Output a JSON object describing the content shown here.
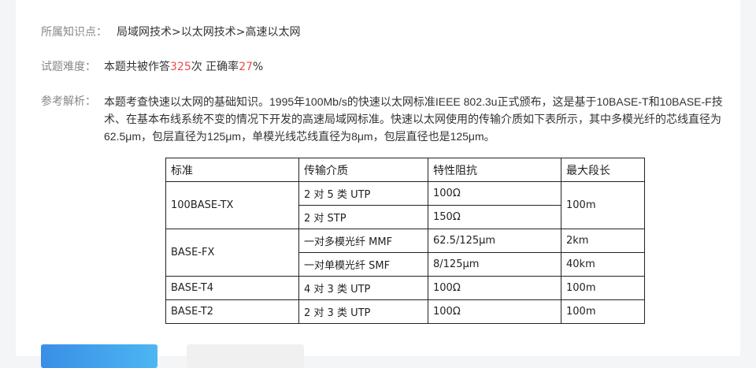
{
  "knowledge": {
    "label": "所属知识点：",
    "value": "局域网技术>以太网技术>高速以太网"
  },
  "difficulty": {
    "label": "试题难度：",
    "prefix": "本题共被作答",
    "count": "325",
    "mid": "次 正确率",
    "rate": "27",
    "suffix": "%"
  },
  "analysis": {
    "label": "参考解析：",
    "text": "本题考查快速以太网的基础知识。1995年100Mb/s的快速以太网标准IEEE 802.3u正式颁布，这是基于10BASE-T和10BASE-F技术、在基本布线系统不变的情况下开发的高速局域网标准。快速以太网使用的传输介质如下表所示，其中多模光纤的芯线直径为62.5μm，包层直径为125μm，单模光线芯线直径为8μm，包层直径也是125μm。"
  },
  "table": {
    "headers": [
      "标准",
      "传输介质",
      "特性阻抗",
      "最大段长"
    ],
    "rows": [
      {
        "standard": "100BASE-TX",
        "media": "2 对 5 类 UTP",
        "impedance": "100Ω",
        "length": "100m"
      },
      {
        "standard": "",
        "media": "2 对 STP",
        "impedance": "150Ω",
        "length": ""
      },
      {
        "standard": "BASE-FX",
        "media": "一对多模光纤 MMF",
        "impedance": "62.5/125μm",
        "length": "2km"
      },
      {
        "standard": "",
        "media": "一对单模光纤 SMF",
        "impedance": "8/125μm",
        "length": "40km"
      },
      {
        "standard": "BASE-T4",
        "media": "4 对 3 类 UTP",
        "impedance": "100Ω",
        "length": "100m"
      },
      {
        "standard": "BASE-T2",
        "media": "2 对 3 类 UTP",
        "impedance": "100Ω",
        "length": "100m"
      }
    ]
  },
  "colors": {
    "accent_red": "#f04848",
    "button_blue": "#3a8ee6"
  }
}
